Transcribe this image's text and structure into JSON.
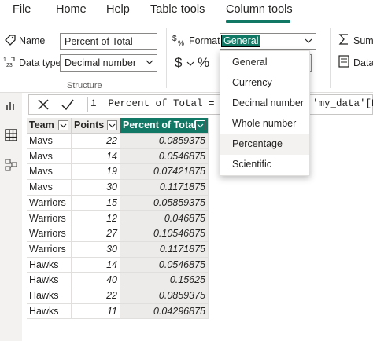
{
  "menu": {
    "tabs": [
      "File",
      "Home",
      "Help",
      "Table tools",
      "Column tools"
    ],
    "active_index": 4
  },
  "ribbon": {
    "name_label": "Name",
    "name_value": "Percent of Total",
    "datatype_label": "Data type",
    "datatype_value": "Decimal number",
    "format_label": "Format",
    "format_value": "General",
    "currency_symbol": "$",
    "percent_symbol": "%",
    "structure_label": "Structure",
    "summarization_label": "Sumr",
    "datacategory_label": "Data"
  },
  "formula_bar": {
    "line_number": "1",
    "text": "Percent of Total = 'my_da",
    "text_right": "'my_data'[Poi"
  },
  "table": {
    "headers": [
      "Team",
      "Points",
      "Percent of Total"
    ],
    "rows": [
      [
        "Mavs",
        "22",
        "0.0859375"
      ],
      [
        "Mavs",
        "14",
        "0.0546875"
      ],
      [
        "Mavs",
        "19",
        "0.07421875"
      ],
      [
        "Mavs",
        "30",
        "0.1171875"
      ],
      [
        "Warriors",
        "15",
        "0.05859375"
      ],
      [
        "Warriors",
        "12",
        "0.046875"
      ],
      [
        "Warriors",
        "27",
        "0.10546875"
      ],
      [
        "Warriors",
        "30",
        "0.1171875"
      ],
      [
        "Hawks",
        "14",
        "0.0546875"
      ],
      [
        "Hawks",
        "40",
        "0.15625"
      ],
      [
        "Hawks",
        "22",
        "0.0859375"
      ],
      [
        "Hawks",
        "11",
        "0.04296875"
      ]
    ]
  },
  "format_dropdown": {
    "options": [
      "General",
      "Currency",
      "Decimal number",
      "Whole number",
      "Percentage",
      "Scientific"
    ],
    "hover_index": 4
  },
  "colors": {
    "accent": "#117865",
    "header_bg": "#edebe9"
  }
}
